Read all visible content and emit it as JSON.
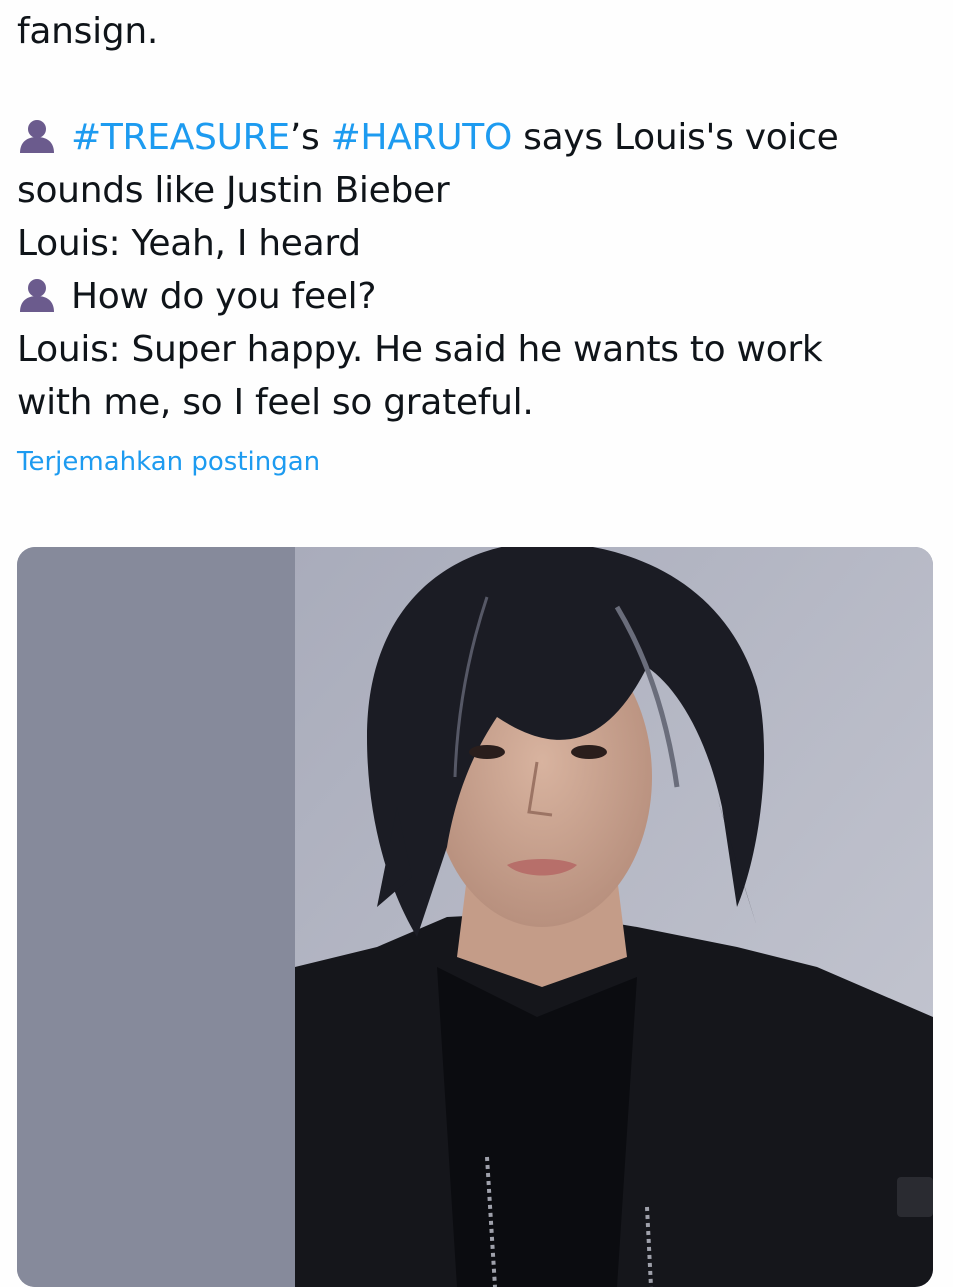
{
  "tweet": {
    "line1": "fansign.",
    "line2": {
      "icon": "bust-in-silhouette-icon",
      "hashtag1": "#TREASURE",
      "connector": "’s ",
      "hashtag2": "#HARUTO",
      "rest": " says Louis's voice"
    },
    "line3": "sounds like Justin Bieber",
    "line4": "Louis: Yeah, I heard",
    "line5": {
      "icon": "bust-in-silhouette-icon",
      "text": "How do you feel?"
    },
    "line6": "Louis: Super happy. He said he wants to work",
    "line7": "with me, so I feel so grateful."
  },
  "translate_label": "Terjemahkan postingan",
  "colors": {
    "link": "#1d9bf0",
    "text": "#0f1419",
    "icon": "#6a5a8a"
  }
}
